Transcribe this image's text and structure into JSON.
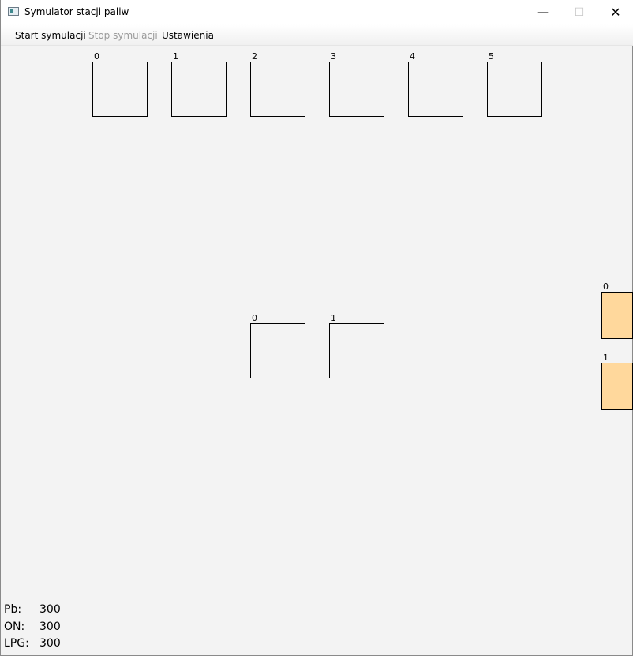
{
  "window": {
    "title": "Symulator stacji paliw",
    "controls": {
      "minimize": "—",
      "maximize": "☐",
      "close": "✕"
    }
  },
  "menu": {
    "start": "Start symulacji",
    "stop": "Stop symulacji",
    "settings": "Ustawienia"
  },
  "distributors": [
    "0",
    "1",
    "2",
    "3",
    "4",
    "5"
  ],
  "cash_desks": [
    "0",
    "1"
  ],
  "queue": [
    "0",
    "1"
  ],
  "fuel_levels": [
    {
      "label": "Pb:",
      "value": "300"
    },
    {
      "label": "ON:",
      "value": "300"
    },
    {
      "label": "LPG:",
      "value": "300"
    }
  ],
  "colors": {
    "background": "#f3f3f3",
    "queue_fill": "#ffd89c"
  }
}
